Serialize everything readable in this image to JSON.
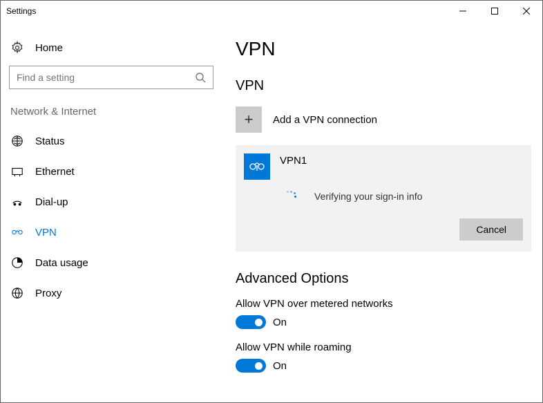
{
  "window": {
    "title": "Settings"
  },
  "sidebar": {
    "home_label": "Home",
    "search_placeholder": "Find a setting",
    "category": "Network & Internet",
    "items": [
      {
        "label": "Status"
      },
      {
        "label": "Ethernet"
      },
      {
        "label": "Dial-up"
      },
      {
        "label": "VPN"
      },
      {
        "label": "Data usage"
      },
      {
        "label": "Proxy"
      }
    ]
  },
  "main": {
    "title": "VPN",
    "section_title": "VPN",
    "add_button_label": "Add a VPN connection",
    "add_button_glyph": "+",
    "connection": {
      "name": "VPN1",
      "status": "Verifying your sign-in info",
      "cancel_label": "Cancel"
    },
    "advanced": {
      "title": "Advanced Options",
      "settings": [
        {
          "label": "Allow VPN over metered networks",
          "state": "On"
        },
        {
          "label": "Allow VPN while roaming",
          "state": "On"
        }
      ]
    }
  }
}
